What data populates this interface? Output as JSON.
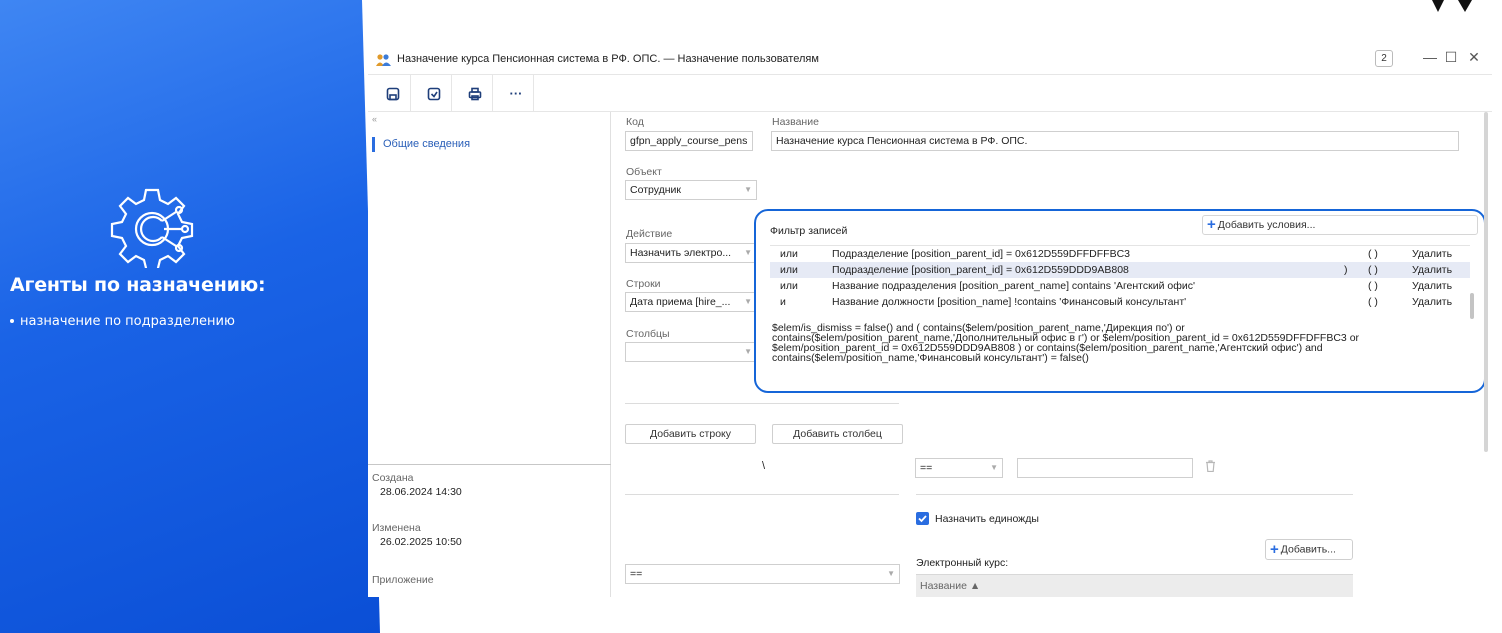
{
  "slide": {
    "title": "Агенты по назначению:",
    "bullet": "назначение по подразделению"
  },
  "window": {
    "title": "Назначение курса Пенсионная система в РФ. ОПС. — Назначение пользователям",
    "badge": "2",
    "controls": {
      "minimize": "—",
      "maximize": "☐",
      "close": "✕"
    }
  },
  "toolbar": {
    "more": "···"
  },
  "sidebar": {
    "collapse": "«",
    "item": "Общие сведения",
    "created_label": "Создана",
    "created_value": "28.06.2024 14:30",
    "modified_label": "Изменена",
    "modified_value": "26.02.2025 10:50",
    "attachment_label": "Приложение"
  },
  "form": {
    "code_label": "Код",
    "code_value": "gfpn_apply_course_pens",
    "name_label": "Название",
    "name_value": "Назначение курса Пенсионная система в РФ. ОПС.",
    "object_label": "Объект",
    "object_value": "Сотрудник",
    "action_label": "Действие",
    "action_value": "Назначить электро...",
    "rows_label": "Строки",
    "rows_value": "Дата приема [hire_...",
    "cols_label": "Столбцы",
    "cols_value": ""
  },
  "filter": {
    "title": "Фильтр записей",
    "add_condition": "Добавить условия...",
    "rows": [
      {
        "op": "или",
        "text": "Подразделение [position_parent_id] = 0x612D559DFFDFFBC3",
        "close": "",
        "paren": "(   )",
        "delete": "Удалить"
      },
      {
        "op": "или",
        "text": "Подразделение [position_parent_id] = 0x612D559DDD9AB808",
        "close": ")",
        "paren": "(   )",
        "delete": "Удалить"
      },
      {
        "op": "или",
        "text": "Название подразделения [position_parent_name] contains 'Агентский офис'",
        "close": "",
        "paren": "(   )",
        "delete": "Удалить"
      },
      {
        "op": "и",
        "text": "Название должности [position_name] !contains 'Финансовый консультант'",
        "close": "",
        "paren": "(   )",
        "delete": "Удалить"
      }
    ],
    "expression": "$elem/is_dismiss = false() and ( contains($elem/position_parent_name,'Дирекция по') or contains($elem/position_parent_name,'Дополнительный офис в г') or $elem/position_parent_id = 0x612D559DFFDFFBC3 or $elem/position_parent_id = 0x612D559DDD9AB808 ) or contains($elem/position_parent_name,'Агентский офис') and contains($elem/position_name,'Финансовый консультант') = false()"
  },
  "bottom": {
    "add_row": "Добавить строку",
    "add_col": "Добавить столбец",
    "backslash": "\\",
    "eq_left": "==",
    "eq_right": "==",
    "assign_once": "Назначить единожды",
    "course_label": "Электронный курс:",
    "add": "Добавить...",
    "col_name": "Название ▲"
  },
  "colors": {
    "accent": "#2a6de0",
    "highlight_border": "#1565d8",
    "selected_row": "#e6eaf5",
    "slide_blue": "#1a63e6"
  }
}
